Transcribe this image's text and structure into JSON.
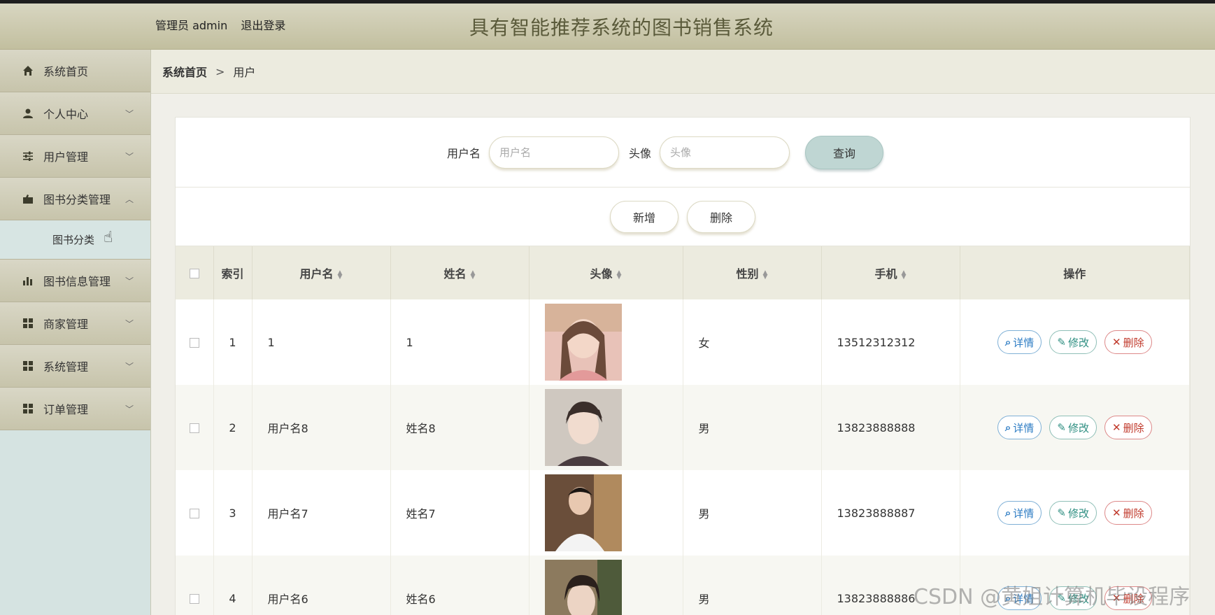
{
  "header": {
    "user_label": "管理员 admin",
    "logout_label": "退出登录",
    "title": "具有智能推荐系统的图书销售系统"
  },
  "sidebar": {
    "items": [
      {
        "label": "系统首页",
        "icon": "home-icon"
      },
      {
        "label": "个人中心",
        "icon": "person-icon"
      },
      {
        "label": "用户管理",
        "icon": "sliders-icon"
      },
      {
        "label": "图书分类管理",
        "icon": "briefcase-icon"
      },
      {
        "label": "图书信息管理",
        "icon": "bar-chart-icon"
      },
      {
        "label": "商家管理",
        "icon": "grid-icon"
      },
      {
        "label": "系统管理",
        "icon": "grid-icon"
      },
      {
        "label": "订单管理",
        "icon": "grid-icon"
      }
    ],
    "submenu_label": "图书分类"
  },
  "breadcrumb": {
    "home": "系统首页",
    "separator": ">",
    "current": "用户"
  },
  "search": {
    "username_label": "用户名",
    "username_placeholder": "用户名",
    "avatar_label": "头像",
    "avatar_placeholder": "头像",
    "query_button": "查询"
  },
  "actions": {
    "add": "新增",
    "delete": "删除"
  },
  "table": {
    "headers": {
      "index": "索引",
      "username": "用户名",
      "name": "姓名",
      "avatar": "头像",
      "gender": "性别",
      "phone": "手机",
      "ops": "操作"
    },
    "row_buttons": {
      "detail": "详情",
      "edit": "修改",
      "delete": "删除"
    },
    "rows": [
      {
        "index": "1",
        "username": "1",
        "name": "1",
        "gender": "女",
        "phone": "13512312312"
      },
      {
        "index": "2",
        "username": "用户名8",
        "name": "姓名8",
        "gender": "男",
        "phone": "13823888888"
      },
      {
        "index": "3",
        "username": "用户名7",
        "name": "姓名7",
        "gender": "男",
        "phone": "13823888887"
      },
      {
        "index": "4",
        "username": "用户名6",
        "name": "姓名6",
        "gender": "男",
        "phone": "13823888886"
      }
    ]
  },
  "watermark": "CSDN @黄姐计算机毕设程序",
  "colors": {
    "header_bg": "#c8c5a8",
    "sidebar_bg": "#d5e3e1",
    "accent_query": "#bfd6d3",
    "detail": "#2d7cc4",
    "edit": "#2f8f82",
    "delete": "#c0392b"
  }
}
